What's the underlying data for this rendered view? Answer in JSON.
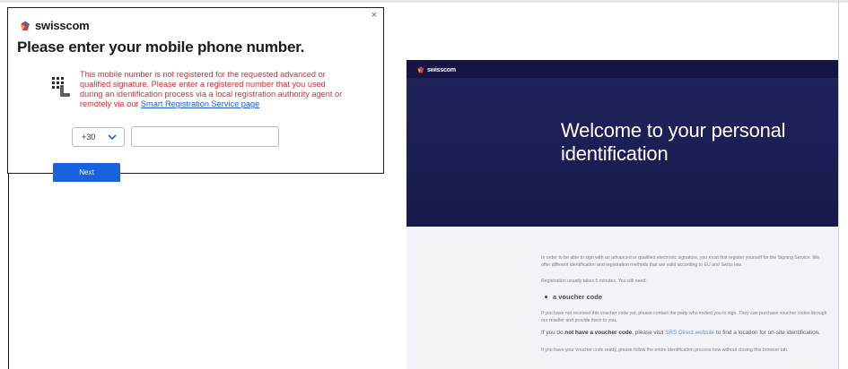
{
  "dialog": {
    "close_glyph": "×",
    "logo_text": "swisscom",
    "title": "Please enter your mobile phone number.",
    "error_text": "This mobile number is not registered for the requested advanced or qualified signature. Please enter a registered number that you used during an identification process via a local registration authority agent or remotely via our ",
    "error_link": "Smart Registration Service page",
    "country_code": "+30",
    "phone_value": "",
    "next_label": "Next",
    "icon": "phone-keypad-icon",
    "colors": {
      "error": "#d12f2f",
      "link": "#1c5cc4",
      "button": "#1862dd"
    }
  },
  "page": {
    "logo_text": "swisscom",
    "hero_title": "Welcome to your personal identification",
    "intro": "In order to be able to sign with an advanced or qualified electronic signature, you must first register yourself for the Signing Service. We offer different identification and registration methods that are valid according to EU and Swiss law.",
    "registration_note": "Registration usually takes 5 minutes. You will need:",
    "bullet": "a voucher code",
    "voucher_info": "If you have not received this voucher code yet, please contact the party who invited you to sign. They can purchase voucher codes through our reseller and provide them to you.",
    "no_voucher_prefix": "If you do ",
    "no_voucher_bold": "not have a voucher code",
    "no_voucher_mid": ", please visit ",
    "no_voucher_link": "SRS Direct website",
    "no_voucher_suffix": " to find a location for on-site identification.",
    "ready_note": "If you have your voucher code ready, please follow the entire identification process now without closing this browser tab.",
    "colors": {
      "hero": "#1c1f55",
      "topbar": "#141544",
      "background": "#f2f3f6"
    }
  }
}
